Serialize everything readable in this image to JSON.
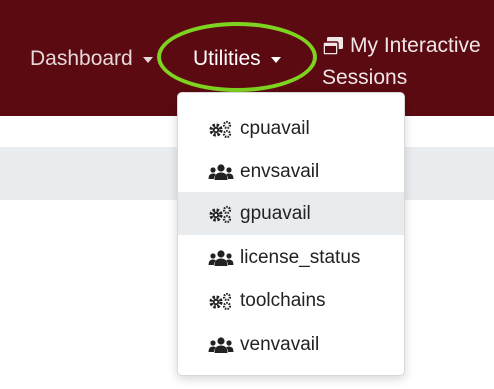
{
  "navbar": {
    "background": "#5c0a11",
    "dashboard_label": "Dashboard",
    "utilities_label": "Utilities",
    "sessions_line1": "My Interactive",
    "sessions_line2": "Sessions"
  },
  "highlight_color": "#7ed321",
  "utilities_menu": {
    "items": [
      {
        "label": "cpuavail",
        "icon": "gears-icon"
      },
      {
        "label": "envsavail",
        "icon": "users-icon"
      },
      {
        "label": "gpuavail",
        "icon": "gears-icon",
        "hovered": true
      },
      {
        "label": "license_status",
        "icon": "users-icon"
      },
      {
        "label": "toolchains",
        "icon": "gears-icon"
      },
      {
        "label": "venvavail",
        "icon": "users-icon"
      }
    ]
  }
}
